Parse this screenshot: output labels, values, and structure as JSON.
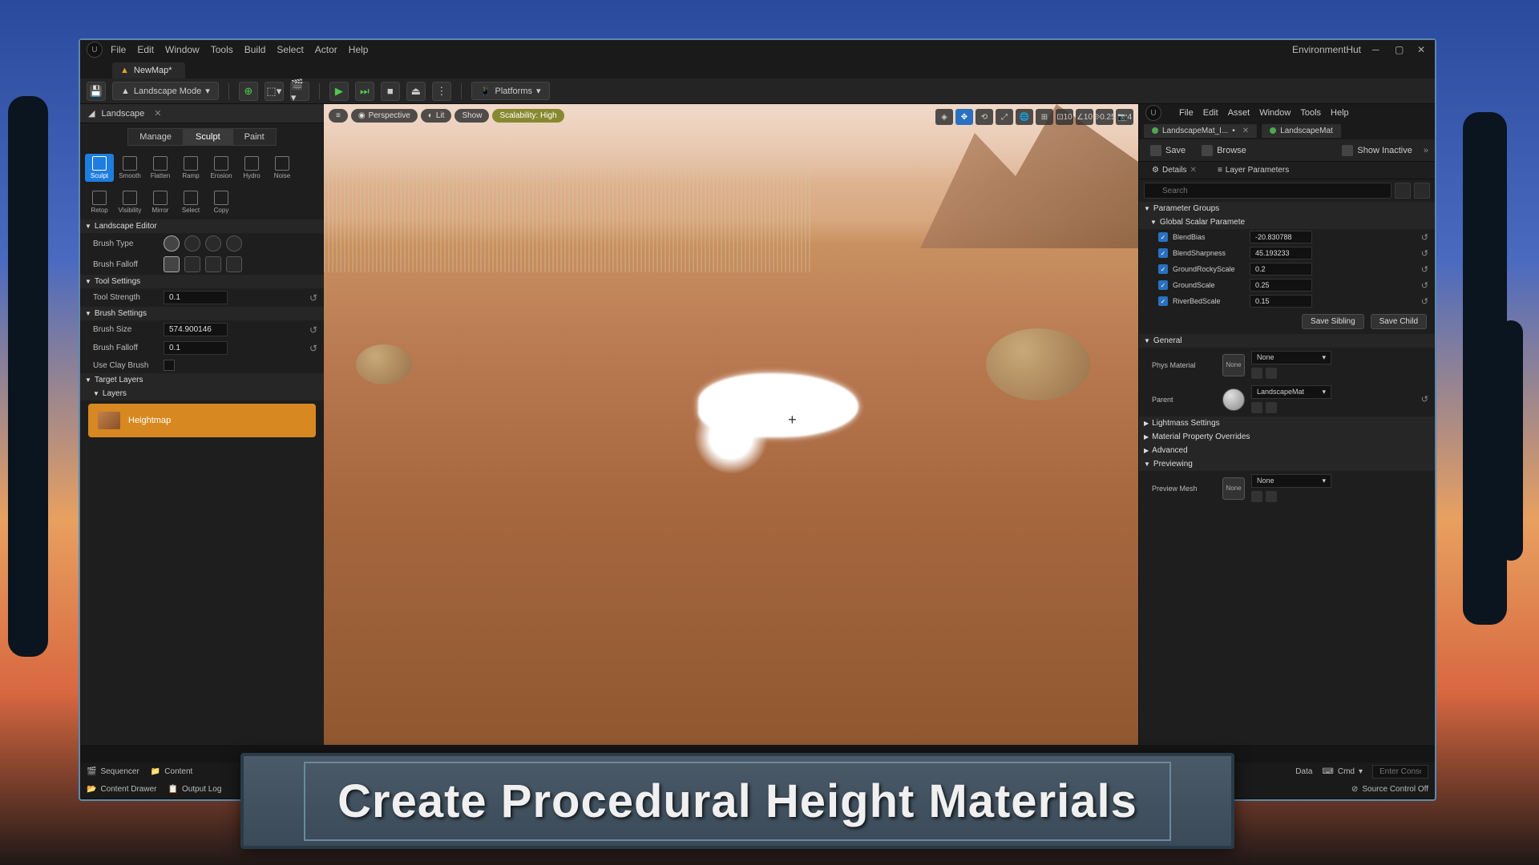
{
  "window": {
    "project": "EnvironmentHut"
  },
  "menu": [
    "File",
    "Edit",
    "Window",
    "Tools",
    "Build",
    "Select",
    "Actor",
    "Help"
  ],
  "doc_tab": "NewMap*",
  "toolbar": {
    "mode": "Landscape Mode",
    "platforms": "Platforms"
  },
  "left": {
    "panel": "Landscape",
    "modes": [
      "Manage",
      "Sculpt",
      "Paint"
    ],
    "active_mode": "Sculpt",
    "tools_row1": [
      "Sculpt",
      "Smooth",
      "Flatten",
      "Ramp",
      "Erosion",
      "Hydro",
      "Noise"
    ],
    "tools_row2": [
      "Retop",
      "Visibility",
      "Mirror",
      "Select",
      "Copy"
    ],
    "active_tool": "Sculpt",
    "sections": {
      "editor": "Landscape Editor",
      "brush_type": "Brush Type",
      "brush_falloff": "Brush Falloff",
      "tool_settings": "Tool Settings",
      "tool_strength_label": "Tool Strength",
      "tool_strength": "0.1",
      "brush_settings": "Brush Settings",
      "brush_size_label": "Brush Size",
      "brush_size": "574.900146",
      "brush_falloff2_label": "Brush Falloff",
      "brush_falloff2": "0.1",
      "use_clay_label": "Use Clay Brush",
      "target_layers": "Target Layers",
      "layers": "Layers",
      "heightmap": "Heightmap"
    }
  },
  "viewport": {
    "left_pills": [
      "Perspective",
      "Lit",
      "Show",
      "Scalability: High"
    ],
    "right_vals": {
      "grid": "10",
      "angle": "10",
      "scale": "0.25",
      "cam": "4"
    }
  },
  "right": {
    "menu": [
      "File",
      "Edit",
      "Asset",
      "Window",
      "Tools",
      "Help"
    ],
    "tabs": [
      {
        "label": "LandscapeMat_I...",
        "dirty": true
      },
      {
        "label": "LandscapeMat",
        "dirty": false
      }
    ],
    "tb": {
      "save": "Save",
      "browse": "Browse",
      "show_inactive": "Show Inactive"
    },
    "subtabs": [
      "Details",
      "Layer Parameters"
    ],
    "search_ph": "Search",
    "groups": {
      "param_groups": "Parameter Groups",
      "global_scalar": "Global Scalar Paramete",
      "params": [
        {
          "name": "BlendBias",
          "val": "-20.830788"
        },
        {
          "name": "BlendSharpness",
          "val": "45.193233"
        },
        {
          "name": "GroundRockyScale",
          "val": "0.2"
        },
        {
          "name": "GroundScale",
          "val": "0.25"
        },
        {
          "name": "RiverBedScale",
          "val": "0.15"
        }
      ],
      "save_sibling": "Save Sibling",
      "save_child": "Save Child",
      "general": "General",
      "phys_mat": "Phys Material",
      "none": "None",
      "parent": "Parent",
      "parent_val": "LandscapeMat",
      "lightmass": "Lightmass Settings",
      "mat_overrides": "Material Property Overrides",
      "advanced": "Advanced",
      "previewing": "Previewing",
      "preview_mesh": "Preview Mesh"
    }
  },
  "bottom": {
    "sequencer": "Sequencer",
    "content": "Content",
    "content_drawer": "Content Drawer",
    "output_log": "Output Log",
    "data": "Data",
    "cmd": "Cmd",
    "cmd_ph": "Enter Console",
    "src": "Source Control Off"
  },
  "banner": "Create Procedural Height Materials"
}
